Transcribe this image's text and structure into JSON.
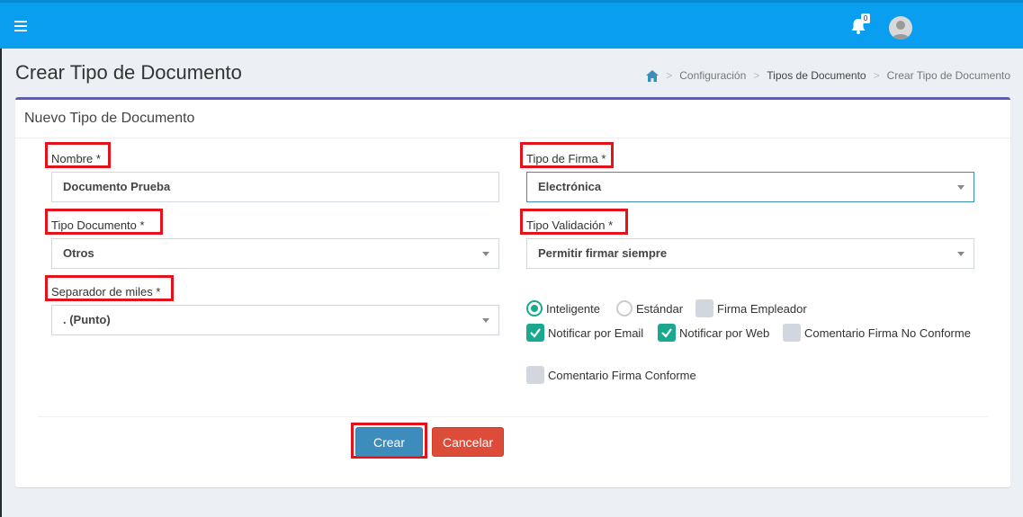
{
  "header": {
    "notification_count": "0"
  },
  "page": {
    "title": "Crear Tipo de Documento"
  },
  "breadcrumb": {
    "items": [
      "Configuración",
      "Tipos de Documento",
      "Crear Tipo de Documento"
    ]
  },
  "form": {
    "box_title": "Nuevo Tipo de Documento",
    "nombre": {
      "label": "Nombre",
      "required": "*",
      "value": "Documento Prueba"
    },
    "tipo_firma": {
      "label": "Tipo de Firma",
      "required": "*",
      "value": "Electrónica"
    },
    "tipo_documento": {
      "label": "Tipo Documento",
      "required": "*",
      "value": "Otros"
    },
    "tipo_validacion": {
      "label": "Tipo Validación",
      "required": "*",
      "value": "Permitir firmar siempre"
    },
    "separador": {
      "label": "Separador de miles",
      "required": "*",
      "value": ". (Punto)"
    },
    "options": {
      "inteligente": "Inteligente",
      "estandar": "Estándar",
      "firma_empleador": "Firma Empleador",
      "notificar_email": "Notificar por Email",
      "notificar_web": "Notificar por Web",
      "comentario_no_conforme": "Comentario Firma No Conforme",
      "comentario_conforme": "Comentario Firma Conforme"
    },
    "buttons": {
      "crear": "Crear",
      "cancelar": "Cancelar"
    }
  },
  "colors": {
    "topbar": "#0a9ef0",
    "accent": "#1aa98f",
    "highlight": "#e3121b",
    "primary_button": "#3c8dbc",
    "danger_button": "#dd4b39",
    "box_border": "#605ca8"
  }
}
